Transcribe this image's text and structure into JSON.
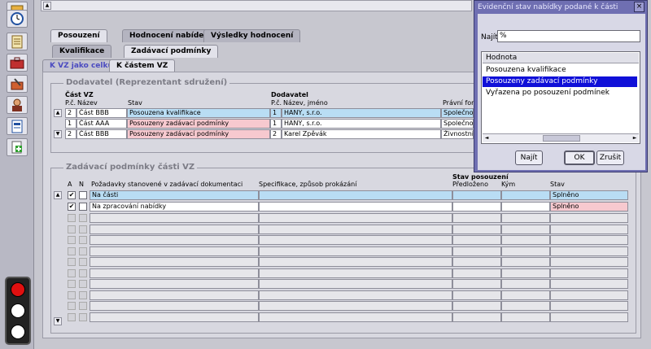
{
  "tabs_primary": [
    "Posouzení",
    "Hodnocení nabídek",
    "Výsledky hodnocení"
  ],
  "tabs_secondary": [
    "Kvalifikace",
    "Zadávací podmínky"
  ],
  "tabs_tertiary": [
    "K VZ jako celku",
    "K částem VZ"
  ],
  "supplier_group": {
    "title": "Dodavatel (Reprezentant sdružení)",
    "header_part": "Část VZ",
    "header_pc": "P.č.",
    "header_name": "Název",
    "header_status": "Stav",
    "header_supplier": "Dodavatel",
    "header_supplier_pc": "P.č.",
    "header_supplier_name": "Název, jméno",
    "header_legal": "Právní forma",
    "rows": [
      {
        "pc": "2",
        "part": "Část BBB",
        "status": "Posouzena kvalifikace",
        "spc": "1",
        "supplier": "HANY, s.r.o.",
        "legal": "Společnost"
      },
      {
        "pc": "1",
        "part": "Část AAA",
        "status": "Posouzeny zadávací podmínky",
        "spc": "1",
        "supplier": "HANY, s.r.o.",
        "legal": "Společnost"
      },
      {
        "pc": "2",
        "part": "Část BBB",
        "status": "Posouzeny zadávací podmínky",
        "spc": "2",
        "supplier": "Karel Zpěvák",
        "legal": "Živnostník"
      }
    ]
  },
  "conditions_group": {
    "title": "Zadávací podmínky části VZ",
    "header_a": "A",
    "header_n": "N",
    "header_req": "Požadavky stanovené v zadávací dokumentaci",
    "header_spec": "Specifikace, způsob prokázání",
    "header_state_group": "Stav posouzení",
    "header_submitted": "Předloženo",
    "header_by": "Kým",
    "header_status": "Stav",
    "rows": [
      {
        "a": true,
        "n": false,
        "req": "Na části",
        "status": "Splněno"
      },
      {
        "a": true,
        "n": false,
        "req": "Na zpracování nabídky",
        "status": "Splněno"
      }
    ]
  },
  "dialog": {
    "title": "Evidenční stav nabídky podané k části",
    "search_label": "Najít",
    "search_value": "%",
    "list_header": "Hodnota",
    "items": [
      "Posouzena kvalifikace",
      "Posouzeny zadávací podmínky",
      "Vyřazena po posouzení podmínek"
    ],
    "selected_index": 1,
    "find_button": "Najít",
    "ok_button": "OK",
    "cancel_button": "Zrušit",
    "close_label": "×"
  },
  "colors": {
    "selected": "#1010d8",
    "row_blue": "#b9ddf4",
    "row_pink": "#f7c9cf",
    "dialog_frame": "#6f6fb2"
  }
}
